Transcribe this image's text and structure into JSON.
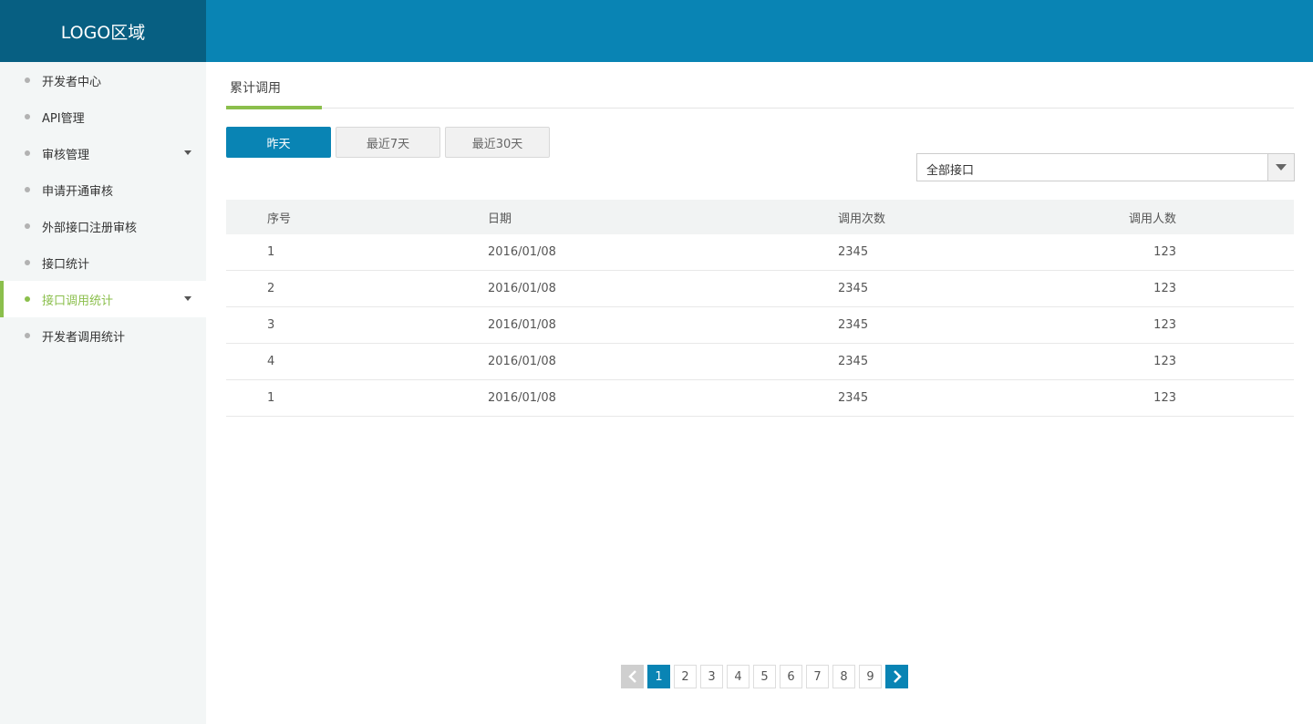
{
  "header": {
    "logo": "LOGO区域"
  },
  "sidebar": {
    "items": [
      {
        "label": "开发者中心"
      },
      {
        "label": "API管理"
      },
      {
        "label": "审核管理"
      },
      {
        "label": "申请开通审核"
      },
      {
        "label": "外部接口注册审核"
      },
      {
        "label": "接口统计"
      },
      {
        "label": "接口调用统计"
      },
      {
        "label": "开发者调用统计"
      }
    ],
    "active_color": "#8bbf4c"
  },
  "tabs": {
    "active": "累计调用"
  },
  "ranges": [
    "昨天",
    "最近7天",
    "最近30天"
  ],
  "filter": {
    "selected": "全部接口"
  },
  "table": {
    "headers": [
      "序号",
      "日期",
      "调用次数",
      "调用人数"
    ],
    "rows": [
      [
        "1",
        "2016/01/08",
        "2345",
        "123"
      ],
      [
        "2",
        "2016/01/08",
        "2345",
        "123"
      ],
      [
        "3",
        "2016/01/08",
        "2345",
        "123"
      ],
      [
        "4",
        "2016/01/08",
        "2345",
        "123"
      ],
      [
        "1",
        "2016/01/08",
        "2345",
        "123"
      ]
    ]
  },
  "pagination": {
    "pages": [
      "1",
      "2",
      "3",
      "4",
      "5",
      "6",
      "7",
      "8",
      "9"
    ],
    "current": "1"
  },
  "colors": {
    "primary": "#0984b4",
    "logo_bg": "#075f82",
    "accent": "#8bbf4c"
  }
}
